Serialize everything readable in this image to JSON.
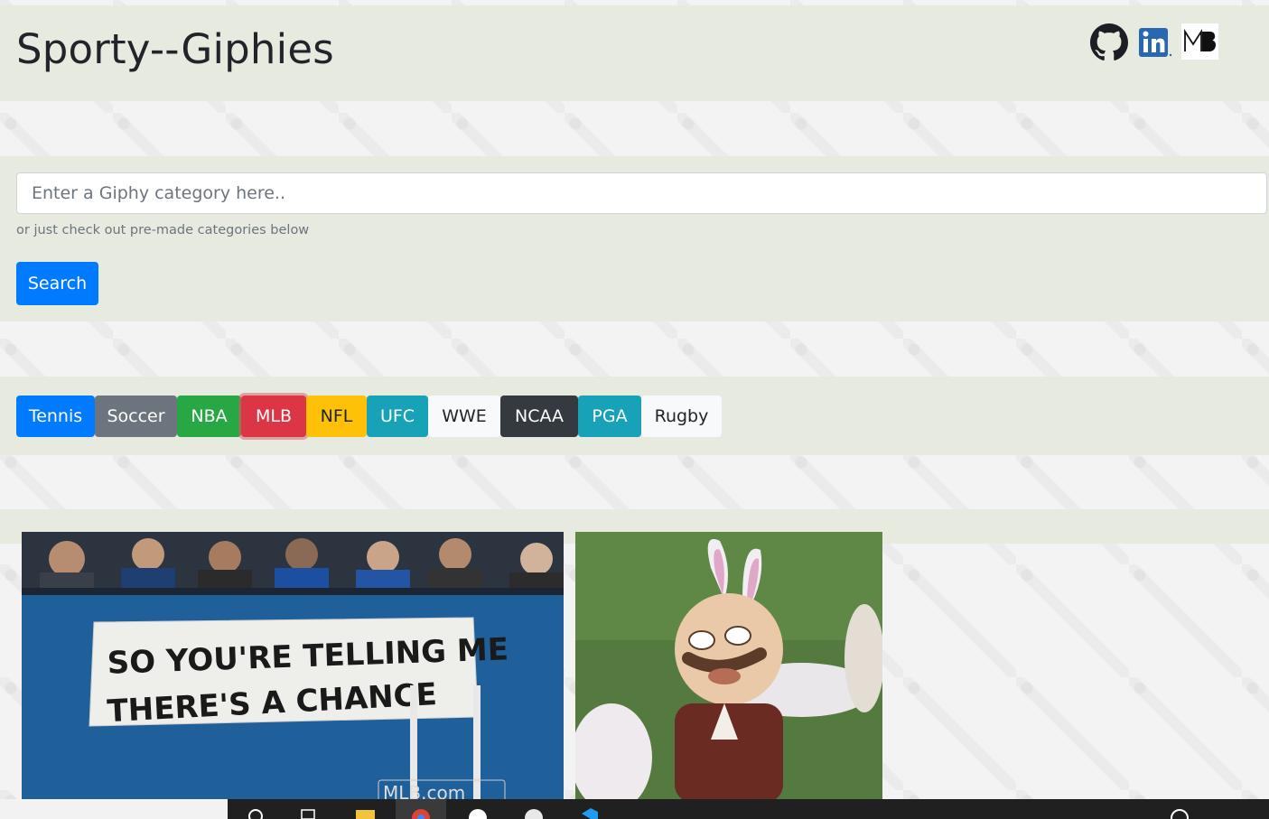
{
  "header": {
    "title": "Sporty--Giphies",
    "social": {
      "github": "github-icon",
      "linkedin": "linkedin-icon",
      "mb_logo": "MB"
    }
  },
  "search": {
    "placeholder": "Enter a Giphy category here..",
    "value": "",
    "hint": "or just check out pre-made categories below",
    "button_label": "Search"
  },
  "categories": [
    {
      "label": "Tennis",
      "bg": "#007bff",
      "fg": "#ffffff"
    },
    {
      "label": "Soccer",
      "bg": "#6c757d",
      "fg": "#ffffff"
    },
    {
      "label": "NBA",
      "bg": "#28a745",
      "fg": "#ffffff"
    },
    {
      "label": "MLB",
      "bg": "#dc3545",
      "fg": "#ffffff",
      "focused": true
    },
    {
      "label": "NFL",
      "bg": "#ffc107",
      "fg": "#212529"
    },
    {
      "label": "UFC",
      "bg": "#17a2b8",
      "fg": "#ffffff"
    },
    {
      "label": "WWE",
      "bg": "#f8f9fa",
      "fg": "#212529"
    },
    {
      "label": "NCAA",
      "bg": "#343a40",
      "fg": "#ffffff"
    },
    {
      "label": "PGA",
      "bg": "#17a2b8",
      "fg": "#ffffff"
    },
    {
      "label": "Rugby",
      "bg": "#f8f9fa",
      "fg": "#212529"
    }
  ],
  "results": [
    {
      "banner_line1": "SO YOU'RE TELLING ME",
      "banner_line2": "THERE'S A CHANCE",
      "watermark": "MLB.com"
    },
    {
      "subject": "mascot-with-bunny-ears"
    }
  ]
}
